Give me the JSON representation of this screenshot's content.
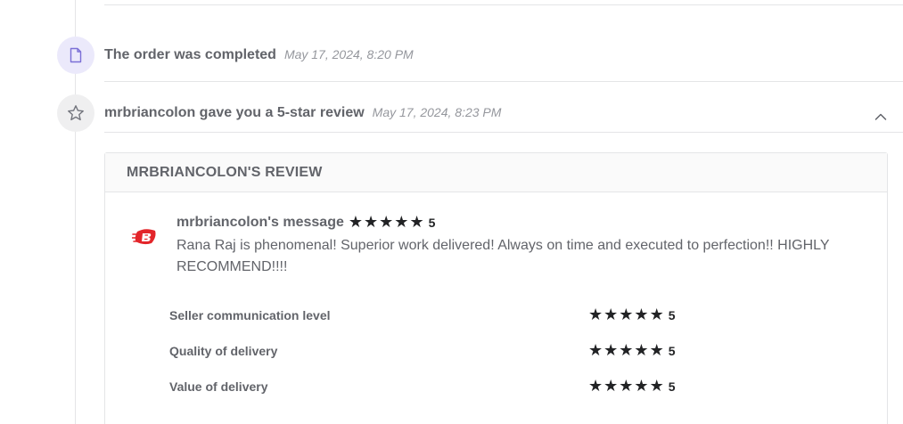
{
  "timeline": {
    "events": [
      {
        "icon": "document-icon",
        "title": "The order was completed",
        "time": "May 17, 2024, 8:20 PM"
      },
      {
        "icon": "star-outline-icon",
        "title": "mrbriancolon gave you a 5-star review",
        "time": "May 17, 2024, 8:23 PM"
      }
    ]
  },
  "review": {
    "header_title": "MRBRIANCOLON'S REVIEW",
    "author_label": "mrbriancolon's message",
    "score": "5",
    "message": "Rana Raj is phenomenal! Superior work delivered! Always on time and executed to perfection!! HIGHLY RECOMMEND!!!!",
    "avatar_icon": "brand-logo-icon",
    "ratings": [
      {
        "label": "Seller communication level",
        "score": "5"
      },
      {
        "label": "Quality of delivery",
        "score": "5"
      },
      {
        "label": "Value of delivery",
        "score": "5"
      }
    ]
  },
  "colors": {
    "doc_icon_bg": "#ebe9fb",
    "doc_icon_stroke": "#7b6fd6",
    "star_icon_bg": "#efeff0",
    "brand_red": "#e3252a",
    "star_fill": "#222325"
  }
}
